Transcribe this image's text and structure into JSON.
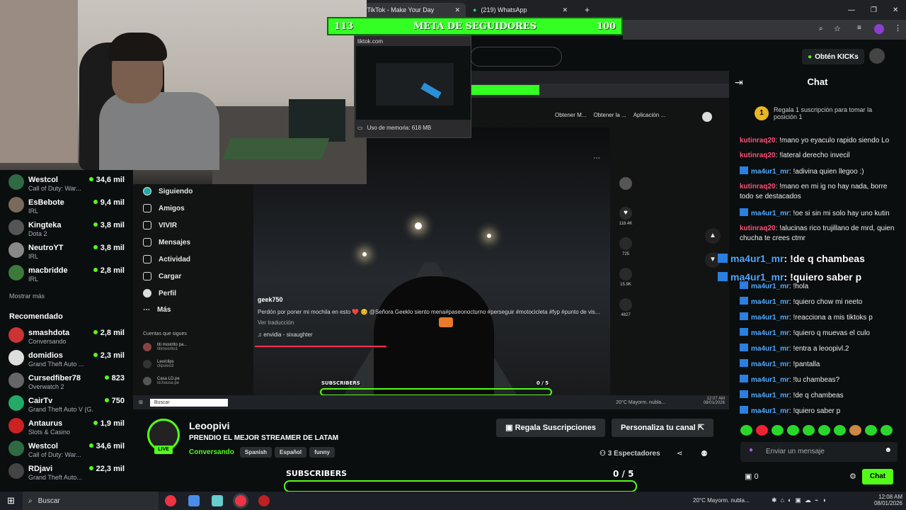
{
  "browser": {
    "tabs": [
      {
        "label": "TikTok - Make Your Day",
        "active": true
      },
      {
        "label": "(219) WhatsApp",
        "active": false
      }
    ]
  },
  "goal": {
    "left": "113",
    "title": "META DE SEGUIDORES",
    "right": "100"
  },
  "tab_preview": {
    "url": "tiktok.com",
    "memory": "Uso de memoria: 618 MB"
  },
  "sidebar": {
    "following": [
      {
        "name": "Westcol",
        "game": "Call of Duty: War...",
        "viewers": "34,6 mil"
      },
      {
        "name": "EsBebote",
        "game": "IRL",
        "viewers": "9,4 mil"
      },
      {
        "name": "Kingteka",
        "game": "Dota 2",
        "viewers": "3,8 mil"
      },
      {
        "name": "NeutroYT",
        "game": "IRL",
        "viewers": "3,8 mil"
      },
      {
        "name": "macbridde",
        "game": "IRL",
        "viewers": "2,8 mil"
      }
    ],
    "show_more": "Mostrar más",
    "recommended_title": "Recomendado",
    "recommended": [
      {
        "name": "smashdota",
        "game": "Conversando",
        "viewers": "2,8 mil"
      },
      {
        "name": "domidios",
        "game": "Grand Theft Auto ...",
        "viewers": "2,3 mil"
      },
      {
        "name": "Cursedfiber78",
        "game": "Overwatch 2",
        "viewers": "823"
      },
      {
        "name": "CairTv",
        "game": "Grand Theft Auto V (G...",
        "viewers": "750"
      },
      {
        "name": "Antaurus",
        "game": "Slots & Casino",
        "viewers": "1,9 mil"
      },
      {
        "name": "Westcol",
        "game": "Call of Duty: War...",
        "viewers": "34,6 mil"
      },
      {
        "name": "RDjavi",
        "game": "Grand Theft Auto...",
        "viewers": "22,3 mil"
      }
    ]
  },
  "tiktok": {
    "nav": [
      "Siguiendo",
      "Amigos",
      "VIVIR",
      "Mensajes",
      "Actividad",
      "Cargar",
      "Perfil",
      "Más"
    ],
    "following_title": "Cuentas que sigues",
    "following_accounts": [
      {
        "name": "titi mostrito pa...",
        "handle": "titimosrito1"
      },
      {
        "name": "Leo/clips",
        "handle": "clipsleo3"
      },
      {
        "name": "Casa LD.pe",
        "handle": "ld.house.pe"
      }
    ],
    "top_buttons": [
      "Obtener M...",
      "Obtener la ...",
      "Aplicación ..."
    ],
    "video_user": "geek750",
    "video_caption": "Perdón por poner mi mochila en esto ❤️ 😊 @Señora Geeklo siento mena#paseonocturno #perseguir #motocicleta #fyp #punto de vis...",
    "translate": "Ver traducción",
    "sound": "envidia - sixaughter",
    "counts": [
      "118.4K",
      "725",
      "15.9K",
      "4827"
    ],
    "inner_search": "Buscar",
    "inner_weather": "20°C Mayorm. nubla...",
    "inner_time": "12:07 AM",
    "inner_date": "08/01/2026",
    "inner_sub_label": "SUBSCRIBERS",
    "inner_sub_count": "0 / 5"
  },
  "kick": {
    "get_kicks": "Obtén KICKs",
    "chat_title": "Chat"
  },
  "chat": {
    "pinned": "Regala 1 suscripción para tomar la posición 1",
    "messages": [
      {
        "user": "kutinraq20",
        "text": "!mano yo eyaculo rapido siendo Lo",
        "color": "red"
      },
      {
        "user": "kutinraq20",
        "text": "!lateral derecho invecil",
        "color": "red"
      },
      {
        "user": "ma4ur1_mr",
        "text": "!adivina quien llegoo :)",
        "color": "blue"
      },
      {
        "user": "kutinraq20",
        "text": "!mano en mi ig no hay nada, borre todo se destacados",
        "color": "red"
      },
      {
        "user": "ma4ur1_mr",
        "text": "!oe si sin mi solo hay uno kutin",
        "color": "blue"
      },
      {
        "user": "kutinraq20",
        "text": "!alucinas rico trujillano de mrd, quien chucha te crees ctmr",
        "color": "red"
      },
      {
        "user": "ma4ur1_mr",
        "text": "!hola",
        "color": "blue"
      },
      {
        "user": "ma4ur1_mr",
        "text": "!quiero chow mi neeto",
        "color": "blue"
      },
      {
        "user": "ma4ur1_mr",
        "text": "!reacciona a mis tiktoks p",
        "color": "blue"
      },
      {
        "user": "ma4ur1_mr",
        "text": "!quiero q muevas el culo",
        "color": "blue"
      },
      {
        "user": "ma4ur1_mr",
        "text": "!entra a leoopivl.2",
        "color": "blue"
      },
      {
        "user": "ma4ur1_mr",
        "text": "!pantalla",
        "color": "blue"
      },
      {
        "user": "ma4ur1_mr",
        "text": "!tu chambeas?",
        "color": "blue"
      },
      {
        "user": "ma4ur1_mr",
        "text": "!de q chambeas",
        "color": "blue"
      },
      {
        "user": "ma4ur1_mr",
        "text": "!quiero saber p",
        "color": "blue"
      }
    ],
    "overlay": [
      {
        "user": "ma4ur1_mr",
        "text": "!de q chambeas"
      },
      {
        "user": "ma4ur1_mr",
        "text": "!quiero saber p"
      }
    ],
    "input_placeholder": "Enviar un mensaje",
    "kicks_count": "0",
    "send_label": "Chat"
  },
  "streamer": {
    "name": "Leoopivi",
    "title": "PRENDIO EL MEJOR STREAMER DE LATAM",
    "category": "Conversando",
    "tags": [
      "Spanish",
      "Español",
      "funny"
    ],
    "live": "LIVE",
    "gift_subs": "Regala Suscripciones",
    "customize": "Personaliza tu canal",
    "viewers": "3 Espectadores"
  },
  "subscribers": {
    "label": "SUBSCRIBERS",
    "count": "0 / 5"
  },
  "taskbar": {
    "search": "Buscar",
    "weather": "20°C Mayorm. nubla...",
    "time": "12:08 AM",
    "date": "08/01/2026"
  },
  "colors": {
    "accent": "#53fc18",
    "goal_bg": "#33ff22",
    "user_red": "#ff4f77",
    "user_blue": "#4fa8ff"
  }
}
